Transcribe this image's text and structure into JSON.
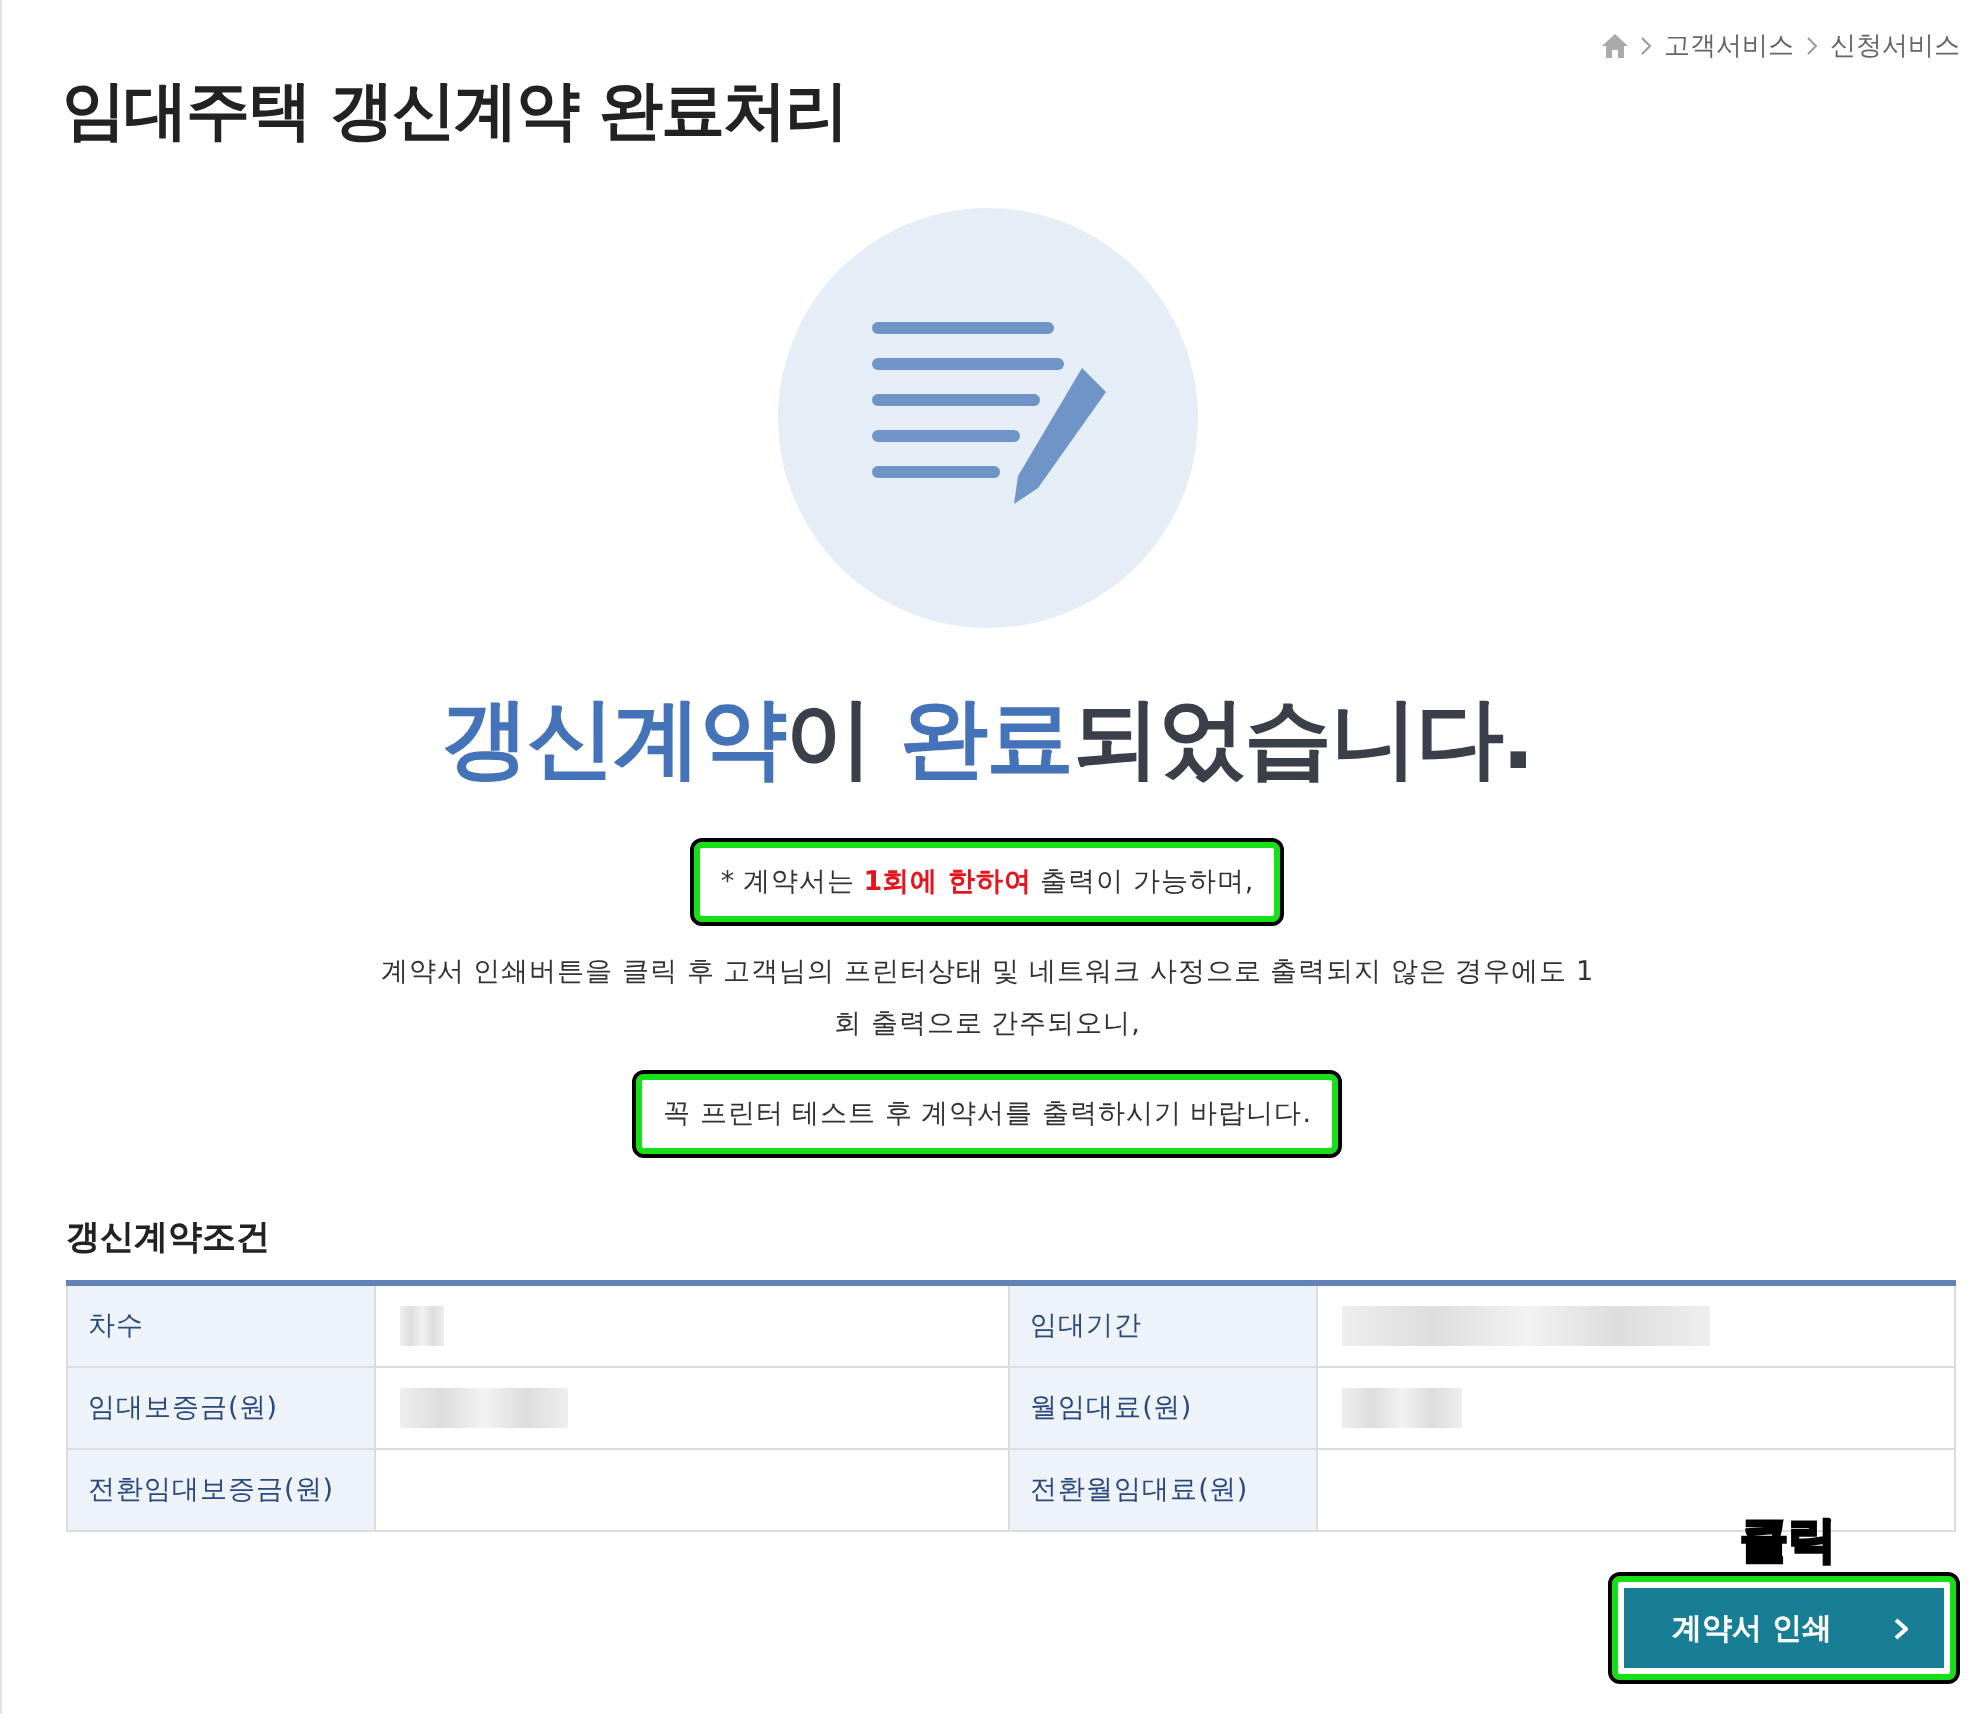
{
  "breadcrumb": [
    "고객서비스",
    "신청서비스"
  ],
  "title": "임대주택 갱신계약 완료처리",
  "headline": "**갱신계약**이 **완료**되었습니다.",
  "notices": [
    {
      "text": "* 계약서는 **1회에 한하여** 출력이 가능하며,",
      "highlighted": true
    },
    {
      "text": "계약서 인쇄버튼을 클릭 후 고객님의 프린터상태 및 네트워크 사정으로 출력되지 않은 경우에도 1회 출력으로 간주되오니,",
      "highlighted": false
    },
    {
      "text": "꼭 프린터 테스트 후 계약서를 출력하시기 바랍니다.",
      "highlighted": true
    }
  ],
  "section_title": "갱신계약조건",
  "table": {
    "rows": [
      [
        {
          "label": "차수",
          "redacted": true
        },
        {
          "label": "임대기간",
          "redacted": true
        }
      ],
      [
        {
          "label": "임대보증금(원)",
          "redacted": true
        },
        {
          "label": "월임대료(원)",
          "redacted": true
        }
      ],
      [
        {
          "label": "전환임대보증금(원)",
          "redacted": false
        },
        {
          "label": "전환월임대료(원)",
          "redacted": false
        }
      ]
    ]
  },
  "print_button": {
    "label": "계약서 인쇄",
    "highlighted": true,
    "annotation": "클릭"
  }
}
